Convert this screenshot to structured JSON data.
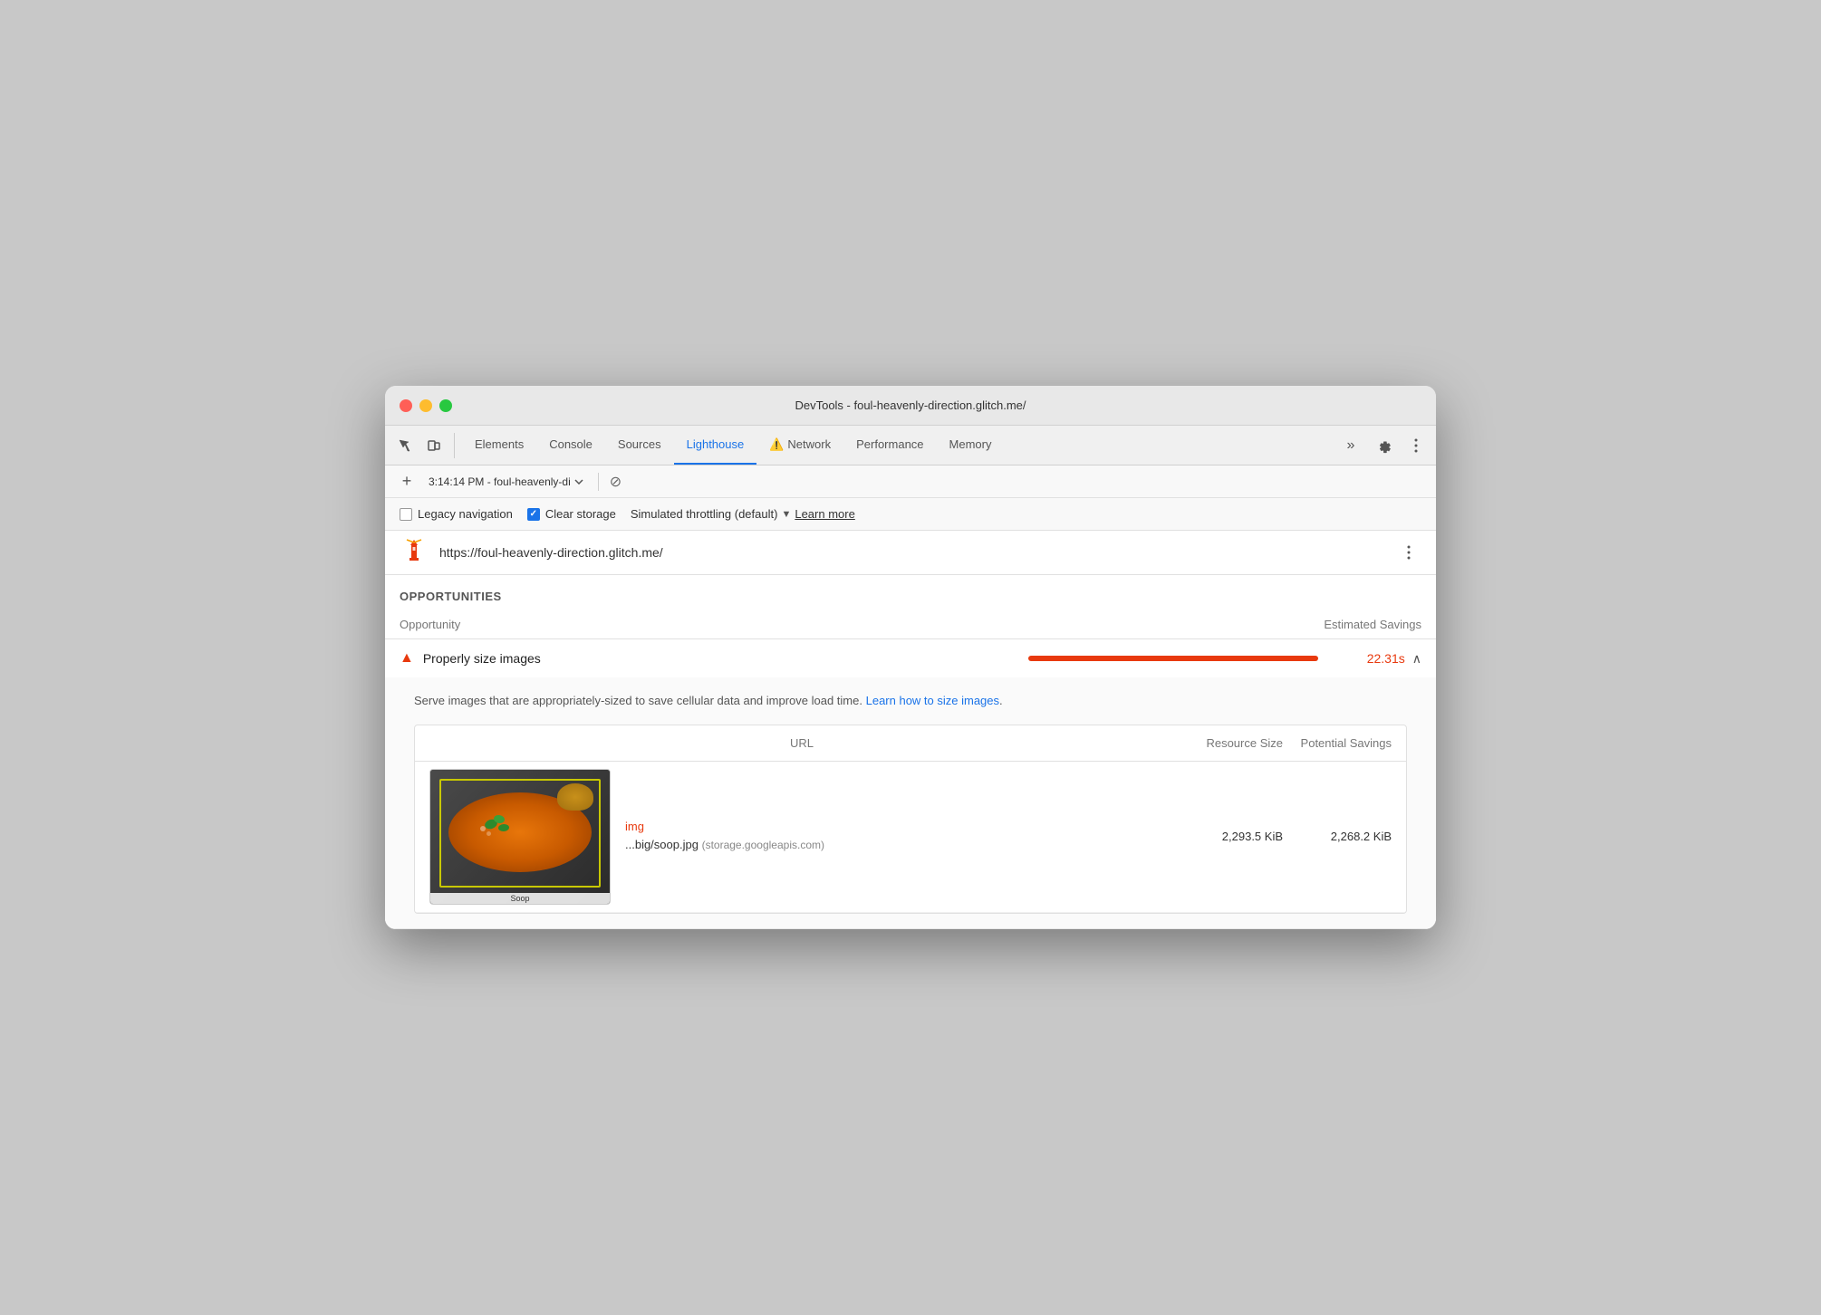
{
  "window": {
    "title": "DevTools - foul-heavenly-direction.glitch.me/"
  },
  "tabs": [
    {
      "id": "elements",
      "label": "Elements",
      "active": false,
      "warning": false
    },
    {
      "id": "console",
      "label": "Console",
      "active": false,
      "warning": false
    },
    {
      "id": "sources",
      "label": "Sources",
      "active": false,
      "warning": false
    },
    {
      "id": "lighthouse",
      "label": "Lighthouse",
      "active": true,
      "warning": false
    },
    {
      "id": "network",
      "label": "Network",
      "active": false,
      "warning": true
    },
    {
      "id": "performance",
      "label": "Performance",
      "active": false,
      "warning": false
    },
    {
      "id": "memory",
      "label": "Memory",
      "active": false,
      "warning": false
    }
  ],
  "session": {
    "label": "3:14:14 PM - foul-heavenly-di"
  },
  "options": {
    "legacy_navigation": {
      "label": "Legacy navigation",
      "checked": false
    },
    "clear_storage": {
      "label": "Clear storage",
      "checked": true
    },
    "throttling": {
      "label": "Simulated throttling (default)"
    },
    "learn_more": "Learn more"
  },
  "url_bar": {
    "url": "https://foul-heavenly-direction.glitch.me/"
  },
  "section": {
    "opportunities_label": "OPPORTUNITIES",
    "table_header": {
      "opportunity": "Opportunity",
      "estimated_savings": "Estimated Savings"
    }
  },
  "opportunity": {
    "title": "Properly size images",
    "savings": "22.31s",
    "description": "Serve images that are appropriately-sized to save cellular data and improve load time.",
    "learn_link": "Learn how to size images",
    "inner_table": {
      "headers": {
        "url": "URL",
        "resource_size": "Resource Size",
        "potential_savings": "Potential Savings"
      },
      "rows": [
        {
          "tag": "img",
          "filename": "...big/soop.jpg",
          "domain": "(storage.googleapis.com)",
          "resource_size": "2,293.5 KiB",
          "potential_savings": "2,268.2 KiB"
        }
      ]
    }
  },
  "soup_caption": "Soop",
  "more_tabs_label": "»",
  "add_button_label": "+",
  "no_entry_symbol": "⊘"
}
